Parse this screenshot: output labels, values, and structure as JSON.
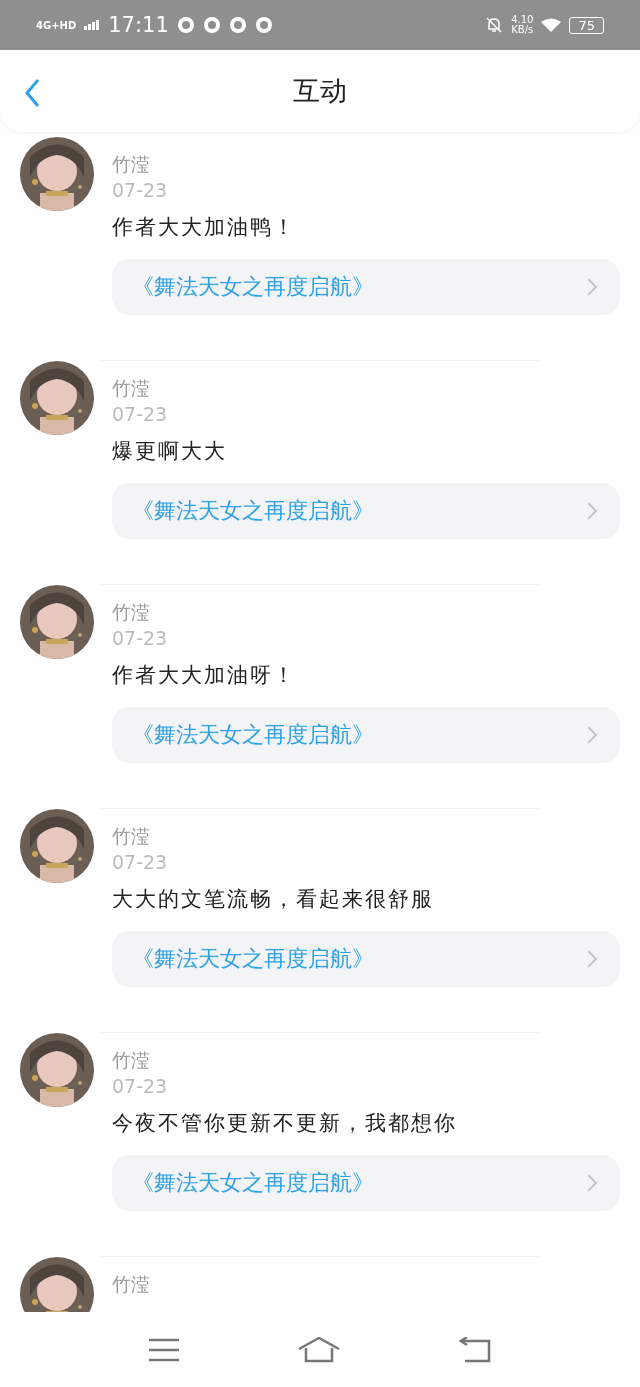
{
  "status_bar": {
    "network": "4G+HD",
    "time": "17:11",
    "speed": "4.10",
    "speed_unit": "KB/s",
    "battery": "75"
  },
  "header": {
    "title": "互动"
  },
  "comments": [
    {
      "name": "竹滢",
      "date": "07-23",
      "text": "作者大大加油鸭！",
      "book": "《舞法天女之再度启航》"
    },
    {
      "name": "竹滢",
      "date": "07-23",
      "text": "爆更啊大大",
      "book": "《舞法天女之再度启航》"
    },
    {
      "name": "竹滢",
      "date": "07-23",
      "text": "作者大大加油呀！",
      "book": "《舞法天女之再度启航》"
    },
    {
      "name": "竹滢",
      "date": "07-23",
      "text": "大大的文笔流畅，看起来很舒服",
      "book": "《舞法天女之再度启航》"
    },
    {
      "name": "竹滢",
      "date": "07-23",
      "text": "今夜不管你更新不更新，我都想你",
      "book": "《舞法天女之再度启航》"
    },
    {
      "name": "竹滢"
    }
  ]
}
